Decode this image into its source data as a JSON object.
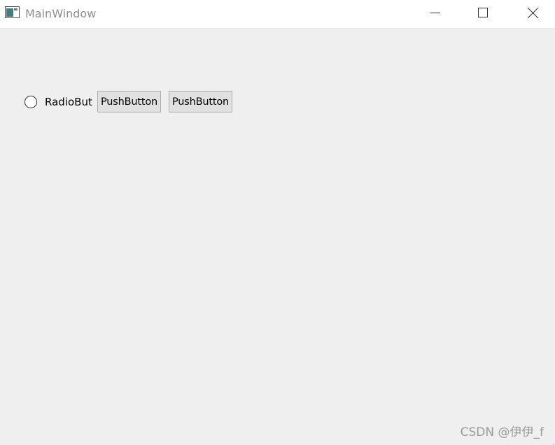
{
  "window": {
    "title": "MainWindow",
    "icon": "qt-window-icon",
    "controls": [
      "minimize-icon",
      "maximize-icon",
      "close-icon"
    ]
  },
  "client": {
    "radio": {
      "label": "RadioBut",
      "checked": false
    },
    "buttons": [
      {
        "label": "PushButton"
      },
      {
        "label": "PushButton"
      }
    ]
  },
  "watermark": {
    "text": "CSDN @伊伊_f"
  }
}
